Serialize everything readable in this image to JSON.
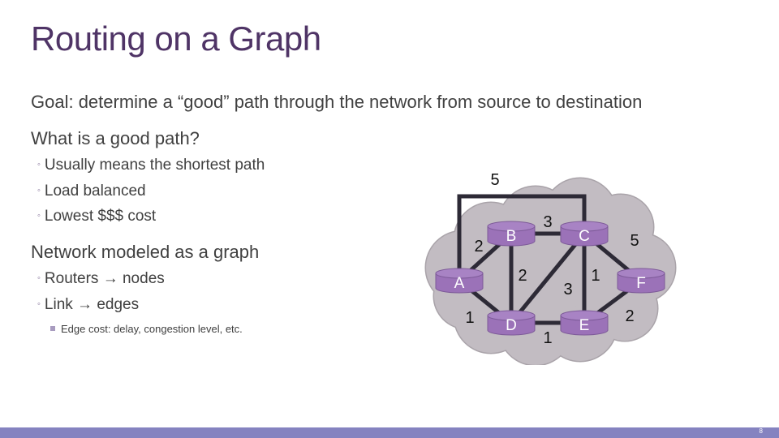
{
  "title": "Routing on a Graph",
  "bullets": {
    "goal": "Goal: determine a “good” path through the network from source to destination",
    "good_path_q": "What is a good path?",
    "good_path_items": [
      "Usually means the shortest path",
      "Load balanced",
      "Lowest $$$ cost"
    ],
    "network_heading": "Network modeled as a graph",
    "network_items": [
      "Routers → nodes",
      "Link → edges"
    ],
    "edge_cost_note": "Edge cost: delay, congestion level, etc."
  },
  "graph": {
    "nodes": [
      "A",
      "B",
      "C",
      "D",
      "E",
      "F"
    ],
    "edges": [
      {
        "from": "A",
        "to": "C",
        "cost": 5
      },
      {
        "from": "A",
        "to": "B",
        "cost": 2
      },
      {
        "from": "A",
        "to": "D",
        "cost": 1
      },
      {
        "from": "B",
        "to": "C",
        "cost": 3
      },
      {
        "from": "B",
        "to": "D",
        "cost": 2
      },
      {
        "from": "C",
        "to": "D",
        "cost": 3
      },
      {
        "from": "C",
        "to": "E",
        "cost": 1
      },
      {
        "from": "C",
        "to": "F",
        "cost": 5
      },
      {
        "from": "D",
        "to": "E",
        "cost": 1
      },
      {
        "from": "E",
        "to": "F",
        "cost": 2
      }
    ],
    "colors": {
      "node": "#9b72b8",
      "node_top": "#a883c4",
      "edge": "#2d2a36",
      "cloud": "#c2bcc2",
      "cloud_stroke": "#a9a3a9"
    }
  },
  "footer": {
    "slide_number": "8",
    "bar_color": "#8583c0"
  }
}
